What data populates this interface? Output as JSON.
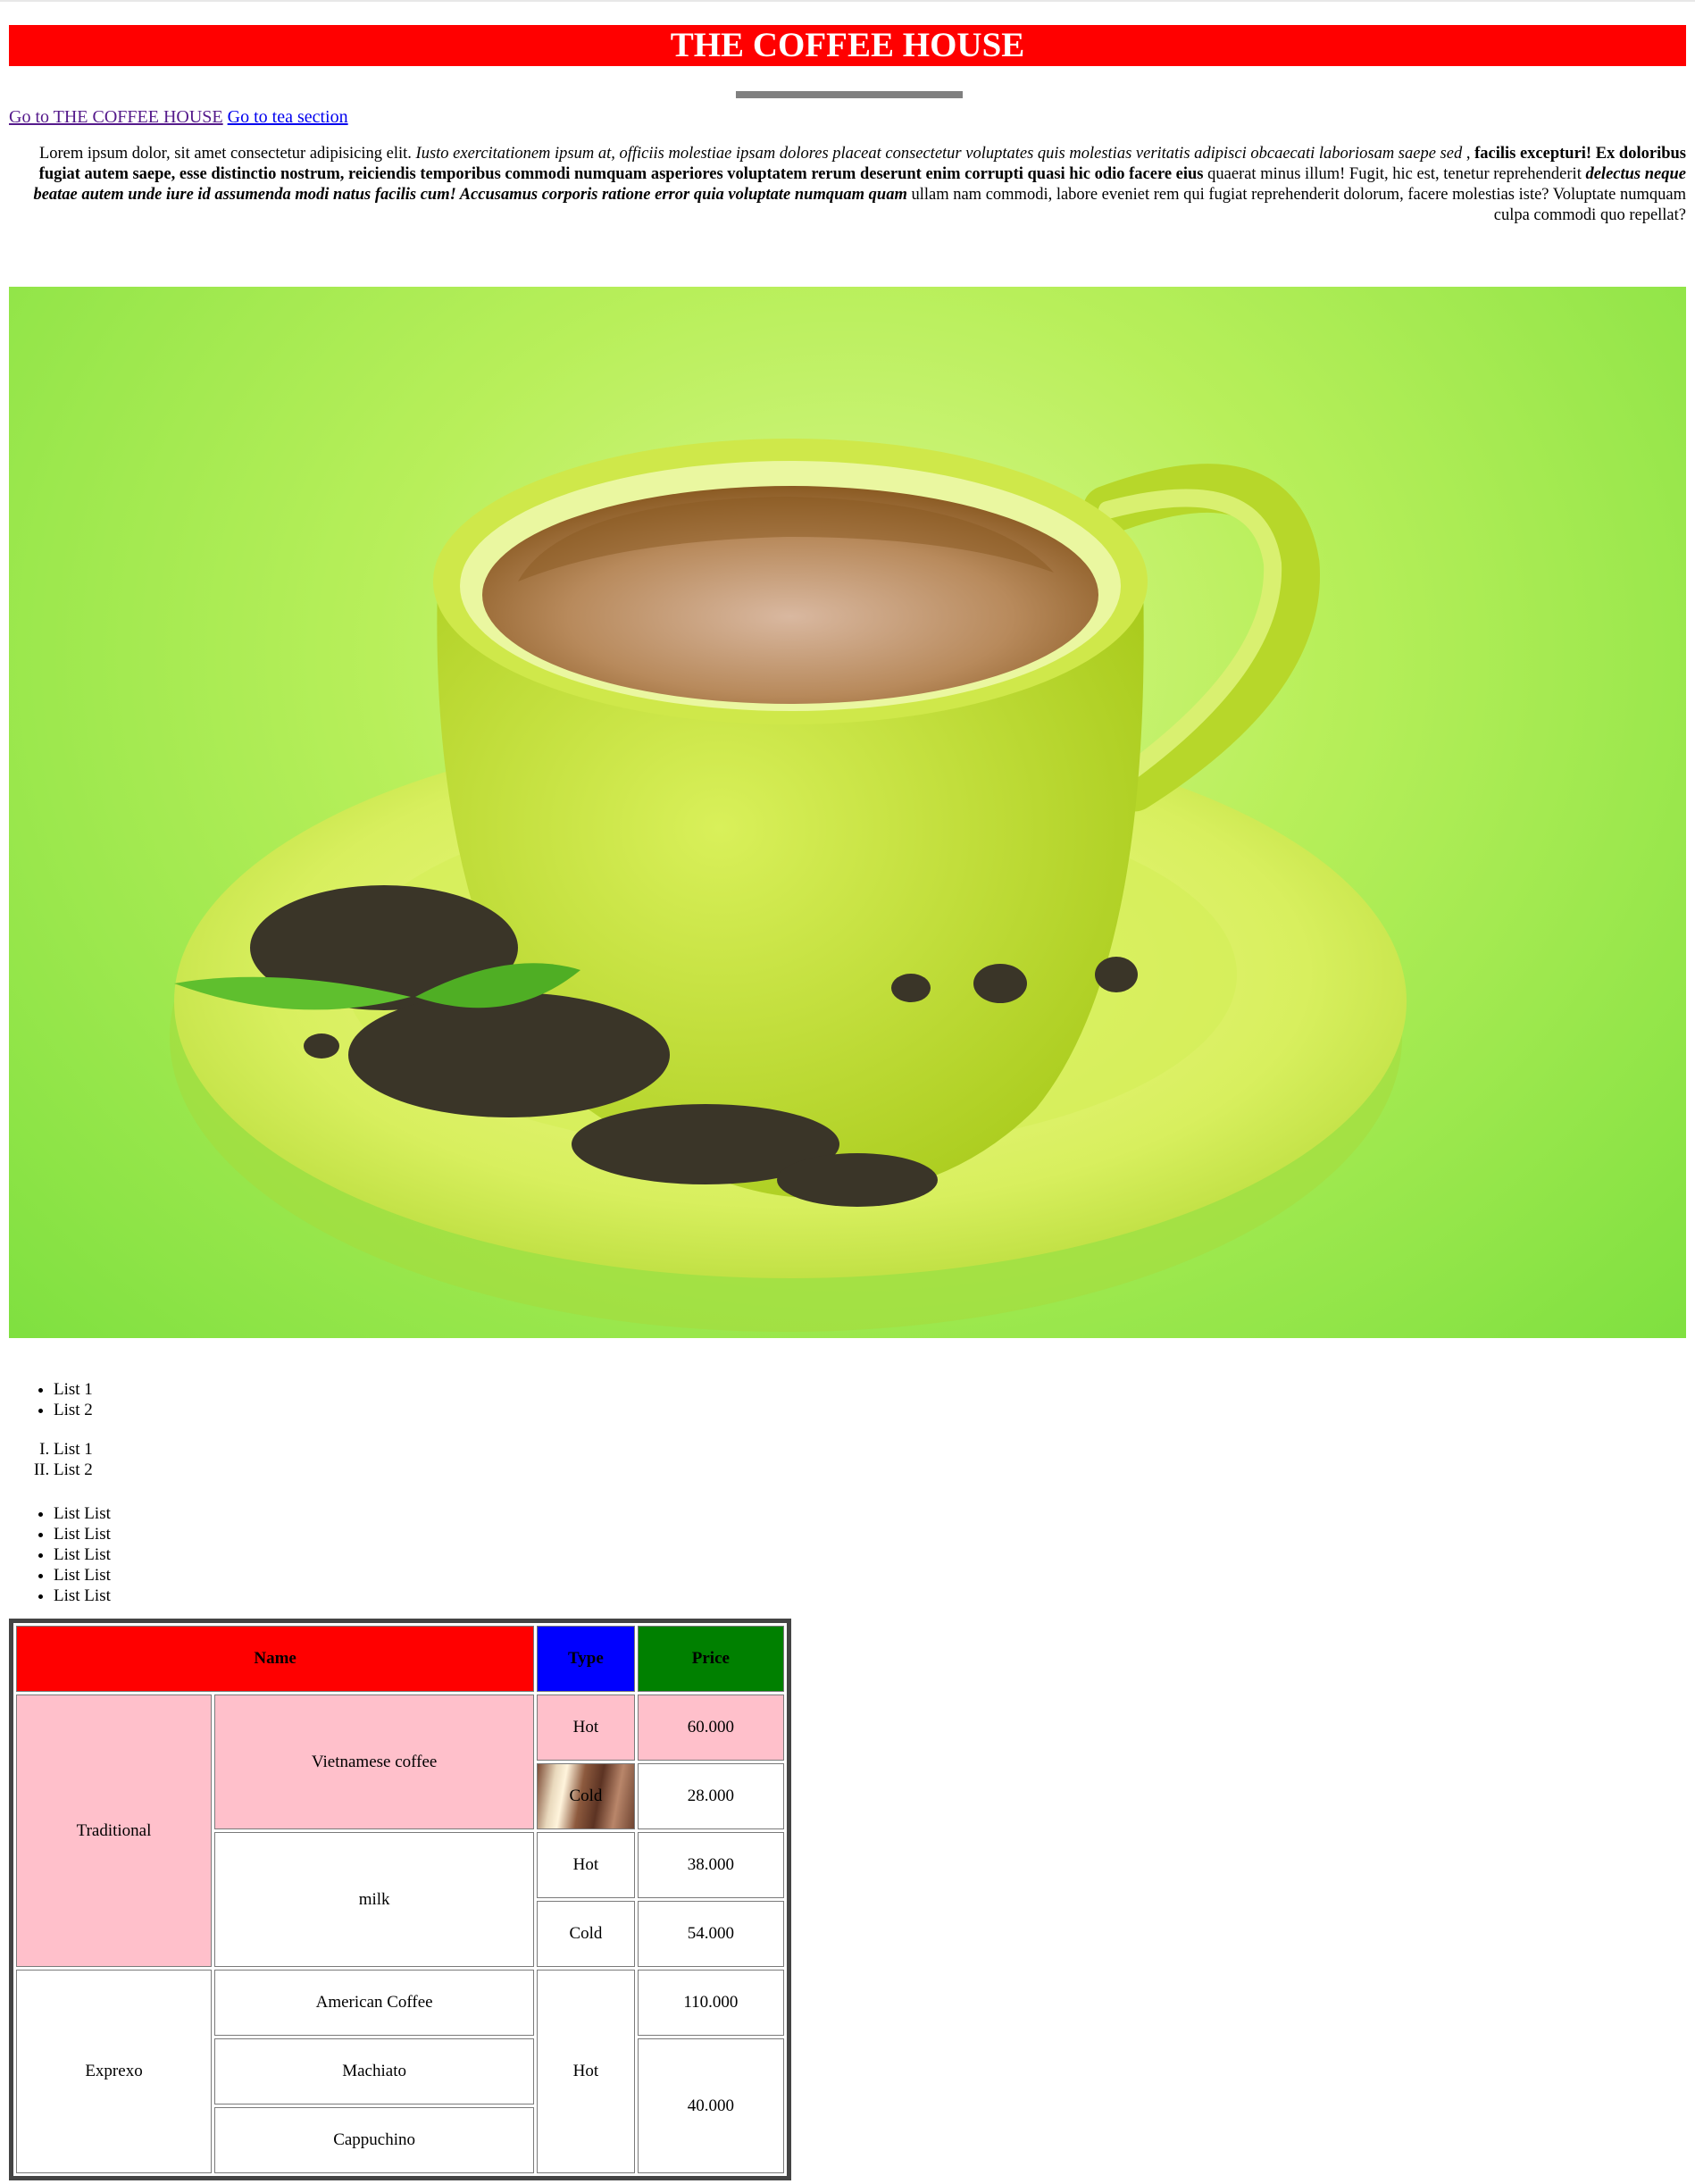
{
  "header": {
    "title": "THE COFFEE HOUSE"
  },
  "nav": {
    "link1": "Go to THE COFFEE HOUSE",
    "link2": "Go to tea section"
  },
  "paragraph": {
    "p1": "Lorem ipsum dolor, sit amet consectetur adipisicing elit. ",
    "p2": "Iusto exercitationem ipsum at, officiis molestiae ipsam dolores placeat consectetur voluptates quis molestias veritatis adipisci obcaecati laboriosam saepe sed",
    "p3": " , ",
    "p4": "facilis excepturi! Ex doloribus fugiat autem saepe, esse distinctio nostrum, reiciendis temporibus commodi numquam asperiores voluptatem rerum deserunt enim corrupti quasi hic odio facere eius",
    "p5": " quaerat minus illum! Fugit, hic est, tenetur reprehenderit ",
    "p6": "delectus neque beatae autem unde iure id assumenda modi natus facilis cum! Accusamus corporis ratione error quia voluptate numquam quam",
    "p7": " ullam nam commodi, labore eveniet rem qui fugiat reprehenderit dolorum, facere molestias iste? Voluptate numquam culpa commodi quo repellat?"
  },
  "image": {
    "description_icon": "green-tea-cup-photo"
  },
  "lists": {
    "unordered1": [
      "List 1",
      "List 2"
    ],
    "ordered": [
      "List 1",
      "List 2"
    ],
    "unordered2": [
      "List List",
      "List List",
      "List List",
      "List List",
      "List List"
    ]
  },
  "table": {
    "headers": {
      "name": "Name",
      "type": "Type",
      "price": "Price"
    },
    "colors": {
      "name_header": "#ff0000",
      "type_header": "#0000ff",
      "price_header": "#008000",
      "highlight": "#ffc0cb"
    },
    "rows": {
      "traditional": "Traditional",
      "vietnamese": "Vietnamese coffee",
      "milk": "milk",
      "exprexo": "Exprexo",
      "american": "American Coffee",
      "machiato": "Machiato",
      "cappuchino": "Cappuchino",
      "hot": "Hot",
      "cold": "Cold",
      "p_viet_hot": "60.000",
      "p_viet_cold": "28.000",
      "p_milk_hot": "38.000",
      "p_milk_cold": "54.000",
      "p_american": "110.000",
      "p_machiato_capp": "40.000"
    }
  }
}
